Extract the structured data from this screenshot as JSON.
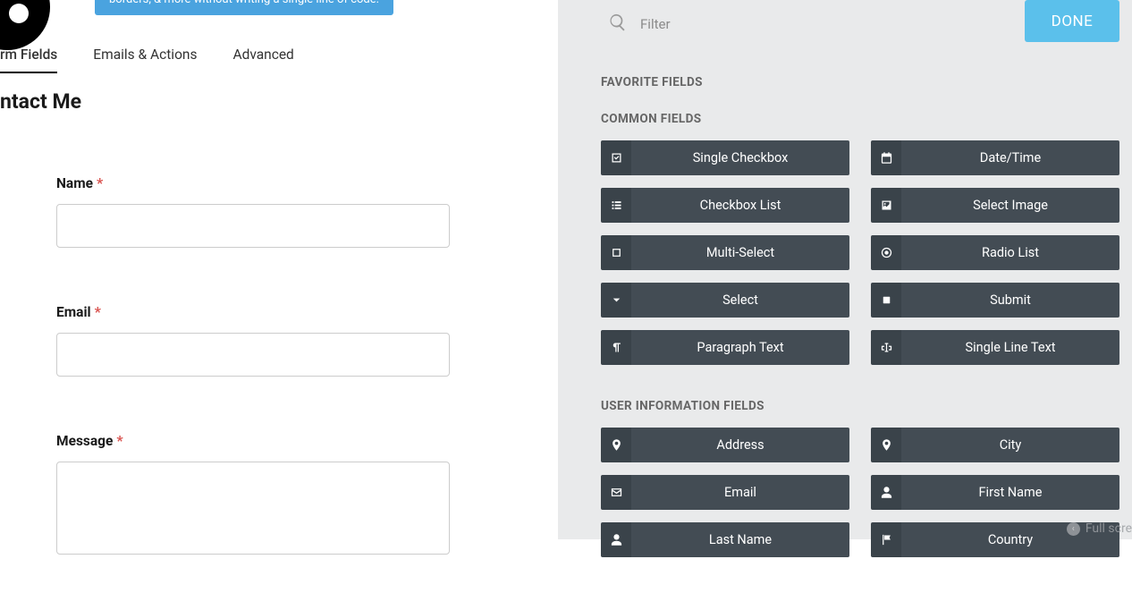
{
  "promo_text": "borders, & more without writing a single line of code.",
  "tabs": {
    "form_fields": "rm Fields",
    "emails_actions": "Emails & Actions",
    "advanced": "Advanced"
  },
  "form": {
    "title": "ntact Me",
    "fields": [
      {
        "label": "Name",
        "required": "*",
        "type": "text"
      },
      {
        "label": "Email",
        "required": "*",
        "type": "text"
      },
      {
        "label": "Message",
        "required": "*",
        "type": "textarea"
      }
    ]
  },
  "drawer": {
    "filter_placeholder": "Filter",
    "done_label": "DONE",
    "sections": {
      "favorite_label": "FAVORITE FIELDS",
      "common_label": "COMMON FIELDS",
      "userinfo_label": "USER INFORMATION FIELDS"
    },
    "common_fields": [
      {
        "label": "Single Checkbox",
        "icon": "checkbox-checked-icon"
      },
      {
        "label": "Date/Time",
        "icon": "calendar-icon"
      },
      {
        "label": "Checkbox List",
        "icon": "list-icon"
      },
      {
        "label": "Select Image",
        "icon": "image-icon"
      },
      {
        "label": "Multi-Select",
        "icon": "square-icon"
      },
      {
        "label": "Radio List",
        "icon": "radio-icon"
      },
      {
        "label": "Select",
        "icon": "chevron-down-icon"
      },
      {
        "label": "Submit",
        "icon": "square-solid-icon"
      },
      {
        "label": "Paragraph Text",
        "icon": "paragraph-icon"
      },
      {
        "label": "Single Line Text",
        "icon": "text-cursor-icon"
      }
    ],
    "user_fields": [
      {
        "label": "Address",
        "icon": "pin-icon"
      },
      {
        "label": "City",
        "icon": "pin-icon"
      },
      {
        "label": "Email",
        "icon": "envelope-icon"
      },
      {
        "label": "First Name",
        "icon": "user-icon"
      },
      {
        "label": "Last Name",
        "icon": "user-icon"
      },
      {
        "label": "Country",
        "icon": "flag-icon"
      }
    ]
  },
  "fullscreen_hint": "Full scre"
}
